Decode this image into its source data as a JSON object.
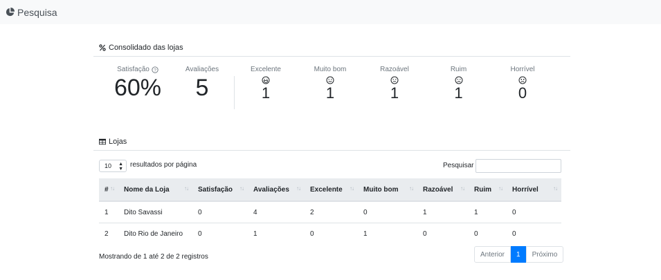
{
  "app": {
    "title": "Pesquisa"
  },
  "consolidado": {
    "title": "Consolidado das lojas",
    "satisfacao_label": "Satisfação",
    "satisfacao_value": "60%",
    "avaliacoes_label": "Avaliações",
    "avaliacoes_value": "5",
    "ratings": [
      {
        "label": "Excelente",
        "value": "1"
      },
      {
        "label": "Muito bom",
        "value": "1"
      },
      {
        "label": "Razoável",
        "value": "1"
      },
      {
        "label": "Ruim",
        "value": "1"
      },
      {
        "label": "Horrível",
        "value": "0"
      }
    ]
  },
  "lojas": {
    "title": "Lojas",
    "page_size": "10",
    "page_size_suffix": "resultados por página",
    "search_label": "Pesquisar",
    "search_value": "",
    "columns": [
      "#",
      "Nome da Loja",
      "Satisfação",
      "Avaliações",
      "Excelente",
      "Muito bom",
      "Razoável",
      "Ruim",
      "Horrível"
    ],
    "rows": [
      [
        "1",
        "Dito Savassi",
        "0",
        "4",
        "2",
        "0",
        "1",
        "1",
        "0"
      ],
      [
        "2",
        "Dito Rio de Janeiro",
        "0",
        "1",
        "0",
        "1",
        "0",
        "0",
        "0"
      ]
    ],
    "info": "Mostrando de 1 até 2 de 2 registros",
    "pagination": {
      "prev": "Anterior",
      "current": "1",
      "next": "Próximo"
    }
  }
}
